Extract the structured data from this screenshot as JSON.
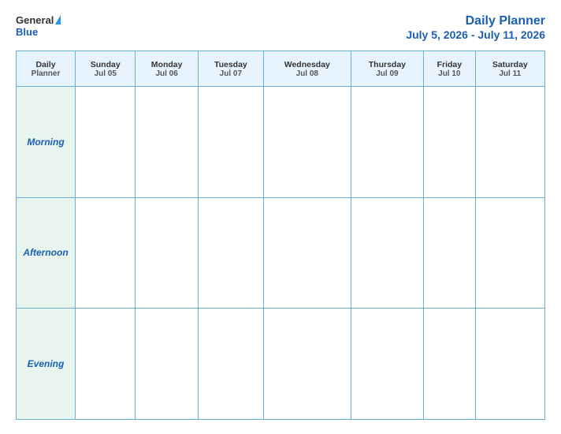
{
  "logo": {
    "general": "General",
    "blue": "Blue"
  },
  "title": {
    "main": "Daily Planner",
    "date_range": "July 5, 2026 - July 11, 2026"
  },
  "columns": [
    {
      "id": "label",
      "top": "Daily",
      "bottom": "Planner",
      "sub": ""
    },
    {
      "id": "sun",
      "top": "Sunday",
      "bottom": "",
      "sub": "Jul 05"
    },
    {
      "id": "mon",
      "top": "Monday",
      "bottom": "",
      "sub": "Jul 06"
    },
    {
      "id": "tue",
      "top": "Tuesday",
      "bottom": "",
      "sub": "Jul 07"
    },
    {
      "id": "wed",
      "top": "Wednesday",
      "bottom": "",
      "sub": "Jul 08"
    },
    {
      "id": "thu",
      "top": "Thursday",
      "bottom": "",
      "sub": "Jul 09"
    },
    {
      "id": "fri",
      "top": "Friday",
      "bottom": "",
      "sub": "Jul 10"
    },
    {
      "id": "sat",
      "top": "Saturday",
      "bottom": "",
      "sub": "Jul 11"
    }
  ],
  "rows": [
    {
      "id": "morning",
      "label": "Morning"
    },
    {
      "id": "afternoon",
      "label": "Afternoon"
    },
    {
      "id": "evening",
      "label": "Evening"
    }
  ]
}
